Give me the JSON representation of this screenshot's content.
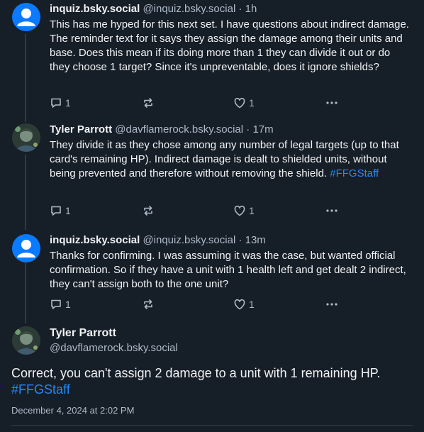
{
  "posts": [
    {
      "name": "inquiz.bsky.social",
      "handle": "@inquiz.bsky.social",
      "time": "1h",
      "text": "This has me hyped for this next set. I have questions about indirect damage. The reminder text for it says they assign the damage among their units and base. Does this mean if its doing more than 1 they can divide it out or do they choose 1 target? Since it's unpreventable, does it ignore shields?",
      "tag": "",
      "replies": "1",
      "likes": "1"
    },
    {
      "name": "Tyler Parrott",
      "handle": "@davflamerock.bsky.social",
      "time": "17m",
      "text": "They divide it as they chose among any number of legal targets (up to that card's remaining HP). Indirect damage is dealt to shielded units, without being prevented and therefore without removing the shield.",
      "tag": "#FFGStaff",
      "replies": "1",
      "likes": "1"
    },
    {
      "name": "inquiz.bsky.social",
      "handle": "@inquiz.bsky.social",
      "time": "13m",
      "text": "Thanks for confirming. I was assuming it was the case, but wanted official confirmation. So if they have a unit with 1 health left and get dealt 2 indirect, they can't assign both to the one unit?",
      "tag": "",
      "replies": "1",
      "likes": "1"
    }
  ],
  "main": {
    "name": "Tyler Parrott",
    "handle": "@davflamerock.bsky.social",
    "text": "Correct, you can't assign 2 damage to a unit with 1 remaining HP.",
    "tag": "#FFGStaff",
    "date": "December 4, 2024 at 2:02 PM"
  },
  "sep": "·",
  "colors": {
    "background": "#161e27",
    "text": "#f1f3f5",
    "muted": "#aebbc9",
    "link": "#208bfe",
    "default_avatar": "#0a7aff"
  },
  "icons": [
    "default-avatar-icon",
    "reply-icon",
    "repost-icon",
    "like-icon",
    "more-icon"
  ]
}
